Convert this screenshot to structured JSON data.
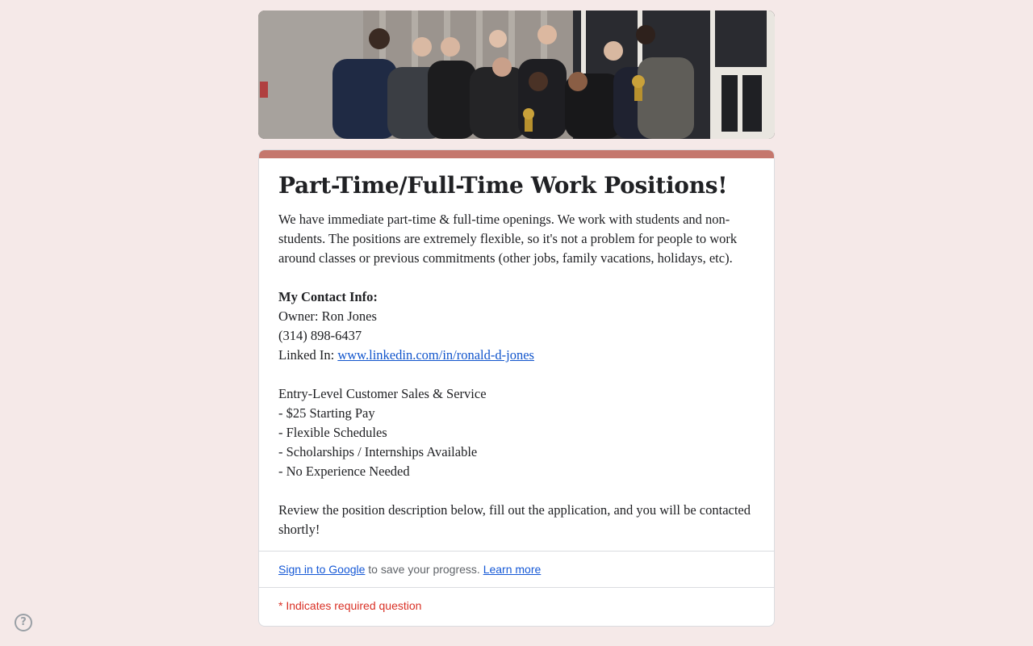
{
  "form": {
    "title": "Part-Time/Full-Time Work Positions!",
    "description": {
      "intro": "We have immediate part-time & full-time openings. We work with students and non-students. The positions are extremely flexible, so it's not a problem for people to work around classes or previous commitments (other jobs, family vacations, holidays, etc).",
      "contact_heading": "My Contact Info:",
      "owner": "Owner: Ron Jones",
      "phone": "(314) 898-6437",
      "linkedin_label": "Linked In: ",
      "linkedin_url": "www.linkedin.com/in/ronald-d-jones",
      "position_title": "Entry-Level Customer Sales & Service",
      "perks": [
        "- $25 Starting Pay",
        "- Flexible Schedules",
        "- Scholarships / Internships Available",
        "- No Experience Needed"
      ],
      "closing": "Review the position description below, fill out the application, and you will be contacted shortly!"
    },
    "signin": {
      "link": "Sign in to Google",
      "text": " to save your progress. ",
      "learn_more": "Learn more"
    },
    "required_note": "* Indicates required question"
  },
  "help": {
    "icon": "question-mark-icon",
    "glyph": "?"
  },
  "colors": {
    "accent": "#c5776d",
    "background": "#f5e9e8",
    "link": "#1155cc",
    "required": "#d93025"
  }
}
